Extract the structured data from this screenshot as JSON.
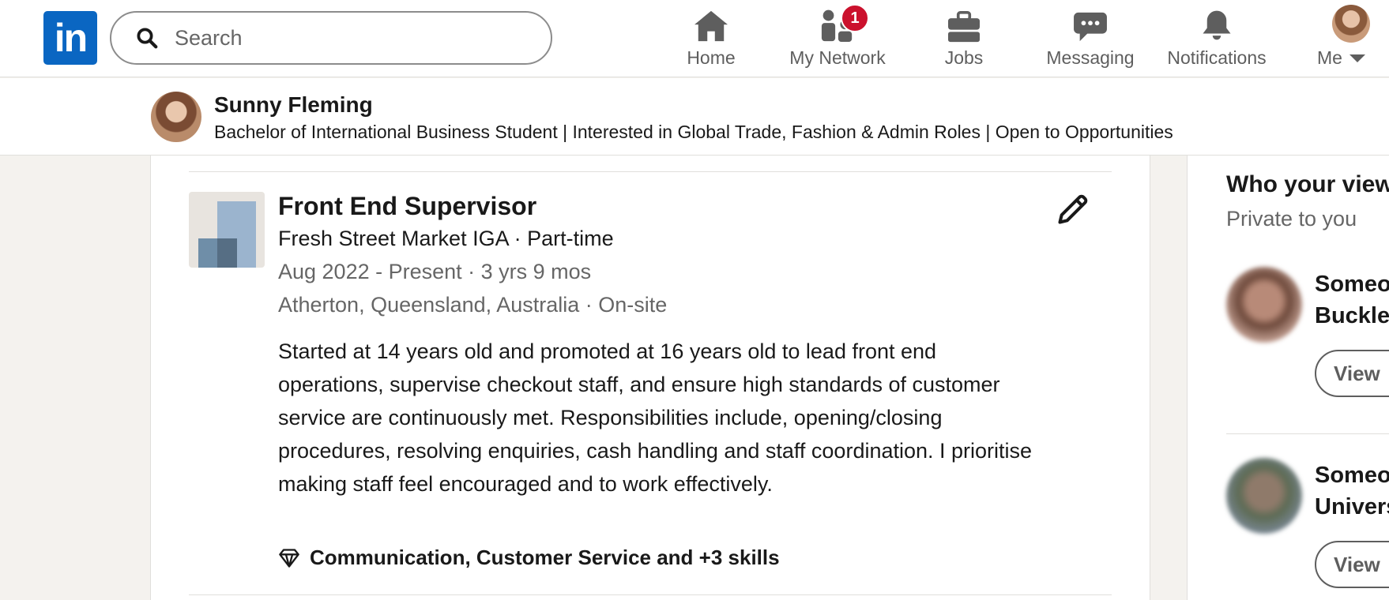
{
  "nav": {
    "logo_text": "in",
    "search_placeholder": "Search",
    "items": [
      {
        "label": "Home",
        "icon": "home-icon"
      },
      {
        "label": "My Network",
        "icon": "my-network-icon",
        "badge": "1"
      },
      {
        "label": "Jobs",
        "icon": "briefcase-icon"
      },
      {
        "label": "Messaging",
        "icon": "messaging-icon"
      },
      {
        "label": "Notifications",
        "icon": "bell-icon"
      },
      {
        "label": "Me",
        "icon": "chevron-down-icon"
      }
    ]
  },
  "profile": {
    "name": "Sunny Fleming",
    "headline": "Bachelor of International Business Student | Interested in Global Trade, Fashion & Admin Roles | Open to Opportunities"
  },
  "experience": {
    "title": "Front End Supervisor",
    "company": "Fresh Street Market IGA · Part-time",
    "dates": "Aug 2022 - Present · 3 yrs 9 mos",
    "location": "Atherton, Queensland, Australia · On-site",
    "description": "Started at 14 years old and promoted at 16 years old to lead front end operations, supervise checkout staff, and ensure high standards of customer service are continuously met. Responsibilities include, opening/closing procedures, resolving enquiries, cash handling and staff coordination. I prioritise making staff feel encouraged and to work effectively.",
    "skills": "Communication, Customer Service and +3 skills",
    "edit_icon": "pencil-icon",
    "skills_icon": "diamond-icon"
  },
  "right_rail": {
    "title": "Who your viewers",
    "subtitle": "Private to you",
    "viewers": [
      {
        "name_line1": "Someone at",
        "name_line2": "Buckley",
        "button": "View"
      },
      {
        "name_line1": "Someone at",
        "name_line2": "University",
        "button": "View"
      }
    ]
  },
  "colors": {
    "brand": "#0a66c2",
    "badge": "#cb112d",
    "page_bg": "#f4f2ee",
    "text_secondary": "#666666"
  }
}
